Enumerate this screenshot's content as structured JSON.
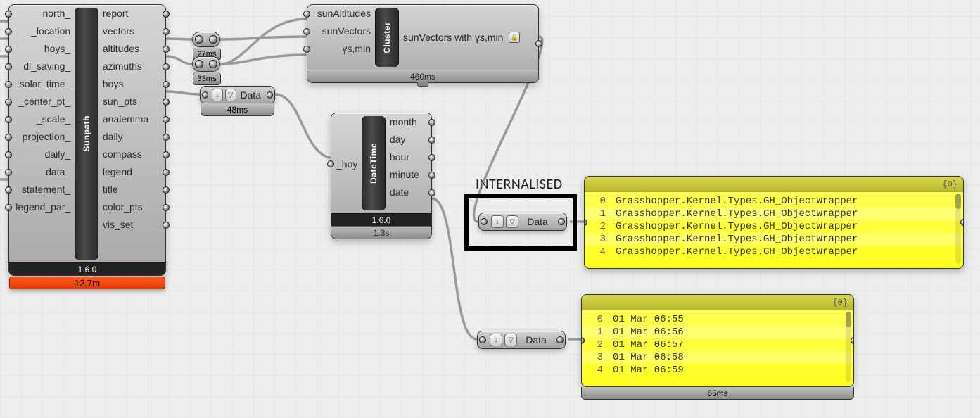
{
  "annotation": "INTERNALISED",
  "sunpath": {
    "name": "Sunpath",
    "version": "1.6.0",
    "runtime": "12.7m",
    "inputs": [
      "north_",
      "_location",
      "hoys_",
      "dl_saving_",
      "solar_time_",
      "_center_pt_",
      "_scale_",
      "projection_",
      "daily_",
      "data_",
      "statement_",
      "legend_par_"
    ],
    "outputs": [
      "report",
      "vectors",
      "altitudes",
      "azimuths",
      "hoys",
      "sun_pts",
      "analemma",
      "daily",
      "compass",
      "legend",
      "title",
      "color_pts",
      "vis_set"
    ]
  },
  "relay1": {
    "time": "27ms"
  },
  "relay2": {
    "time": "33ms"
  },
  "dataparam1": {
    "label": "Data",
    "time": "48ms"
  },
  "cluster": {
    "name": "Cluster",
    "time": "460ms",
    "inputs": [
      "sunAltitudes",
      "sunVectors",
      "γs,min"
    ],
    "output": "sunVectors with γs,min"
  },
  "datetime": {
    "name": "DateTime",
    "version": "1.6.0",
    "time": "1.3s",
    "inputs": [
      "_hoy"
    ],
    "outputs": [
      "month",
      "day",
      "hour",
      "minute",
      "date"
    ]
  },
  "internalised_param": {
    "label": "Data"
  },
  "dataparam2": {
    "label": "Data",
    "time": "65ms"
  },
  "panel1": {
    "path": "{0}",
    "rows": [
      "Grasshopper.Kernel.Types.GH_ObjectWrapper",
      "Grasshopper.Kernel.Types.GH_ObjectWrapper",
      "Grasshopper.Kernel.Types.GH_ObjectWrapper",
      "Grasshopper.Kernel.Types.GH_ObjectWrapper",
      "Grasshopper.Kernel.Types.GH_ObjectWrapper"
    ]
  },
  "panel2": {
    "path": "{0}",
    "rows": [
      "01 Mar 06:55",
      "01 Mar 06:56",
      "01 Mar 06:57",
      "01 Mar 06:58",
      "01 Mar 06:59"
    ]
  }
}
